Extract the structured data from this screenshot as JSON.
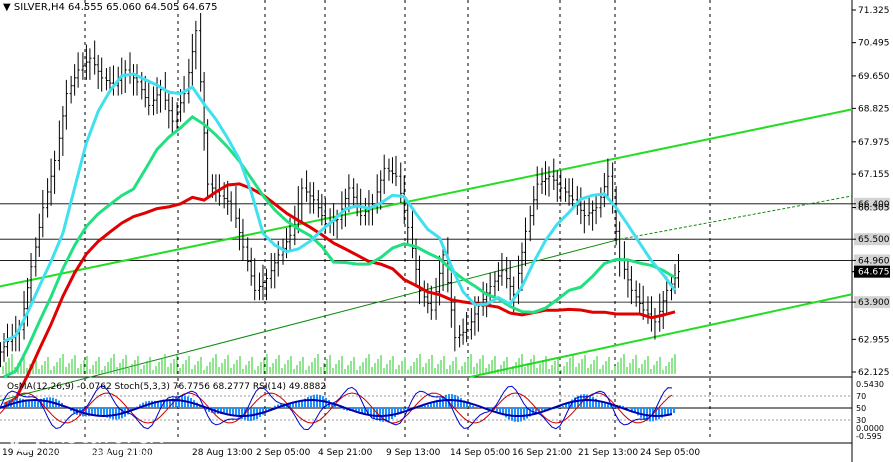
{
  "header": {
    "symbol": "SILVER,H4",
    "ohlc": "64.555 65.060 64.505 64.675"
  },
  "price_axis": {
    "labels": [
      "71.325",
      "70.495",
      "69.650",
      "68.825",
      "67.975",
      "67.155",
      "66.400",
      "66.305",
      "65.500",
      "64.960",
      "64.675",
      "64.675",
      "63.900",
      "62.955",
      "62.125"
    ],
    "highlight": [
      {
        "text": "66.400",
        "color": "#d3d3d3"
      },
      {
        "text": "65.500",
        "color": "#d3d3d3"
      },
      {
        "text": "64.960",
        "color": "#d3d3d3"
      },
      {
        "text": "63.900",
        "color": "#d3d3d3"
      }
    ],
    "current": "64.675",
    "levels": [
      "66.400",
      "65.500",
      "64.960",
      "63.900"
    ]
  },
  "indicator": {
    "header": "OsMA(12,26,9) -0.0762  Stoch(5,3,3) 76.7756 68.2777  RSI(14) 49.8882",
    "axis_labels": [
      "0.5430",
      "70",
      "50",
      "30",
      "0.0000",
      "-0.595"
    ]
  },
  "time_axis": {
    "labels": [
      "19 Aug 2020",
      "23 Aug 21:00",
      "28 Aug 13:00",
      "2 Sep 05:00",
      "4 Sep 21:00",
      "9 Sep 13:00",
      "14 Sep 05:00",
      "16 Sep 21:00",
      "21 Sep 13:00",
      "24 Sep 05:00"
    ]
  },
  "watermark": {
    "name": "instaforex",
    "tagline": "Instant Forex Trading"
  },
  "colors": {
    "ma_red": "#e00000",
    "ma_cyan": "#40e0f0",
    "ma_green": "#20e080",
    "channel": "#22dd22",
    "bars": "#000000",
    "osma": "#1e90ff",
    "stoch_main": "#0000cc",
    "stoch_signal": "#cc0000",
    "rsi": "#9090c0"
  },
  "chart_data": {
    "type": "line",
    "candles_close": [
      62.9,
      63.2,
      64.8,
      66.3,
      67.5,
      69.2,
      69.8,
      70.1,
      69.6,
      69.4,
      69.8,
      69.5,
      68.9,
      69.3,
      68.5,
      69.2,
      70.8,
      66.9,
      66.6,
      66.4,
      65.3,
      64.2,
      64.5,
      65.1,
      65.6,
      66.8,
      66.5,
      65.9,
      66.0,
      66.8,
      66.1,
      66.4,
      67.3,
      67.1,
      65.8,
      64.2,
      63.7,
      65.1,
      63.0,
      63.2,
      63.8,
      64.3,
      64.7,
      64.1,
      65.7,
      66.9,
      67.1,
      66.8,
      66.5,
      66.1,
      66.3,
      67.1,
      65.0,
      64.2,
      63.7,
      63.4,
      64.2,
      64.675
    ],
    "price_range": [
      62.125,
      71.325
    ],
    "series": [
      {
        "name": "",
        "color_key": "ma_red"
      },
      {
        "name": "",
        "color_key": "ma_cyan"
      },
      {
        "name": "",
        "color_key": "ma_green"
      }
    ]
  }
}
